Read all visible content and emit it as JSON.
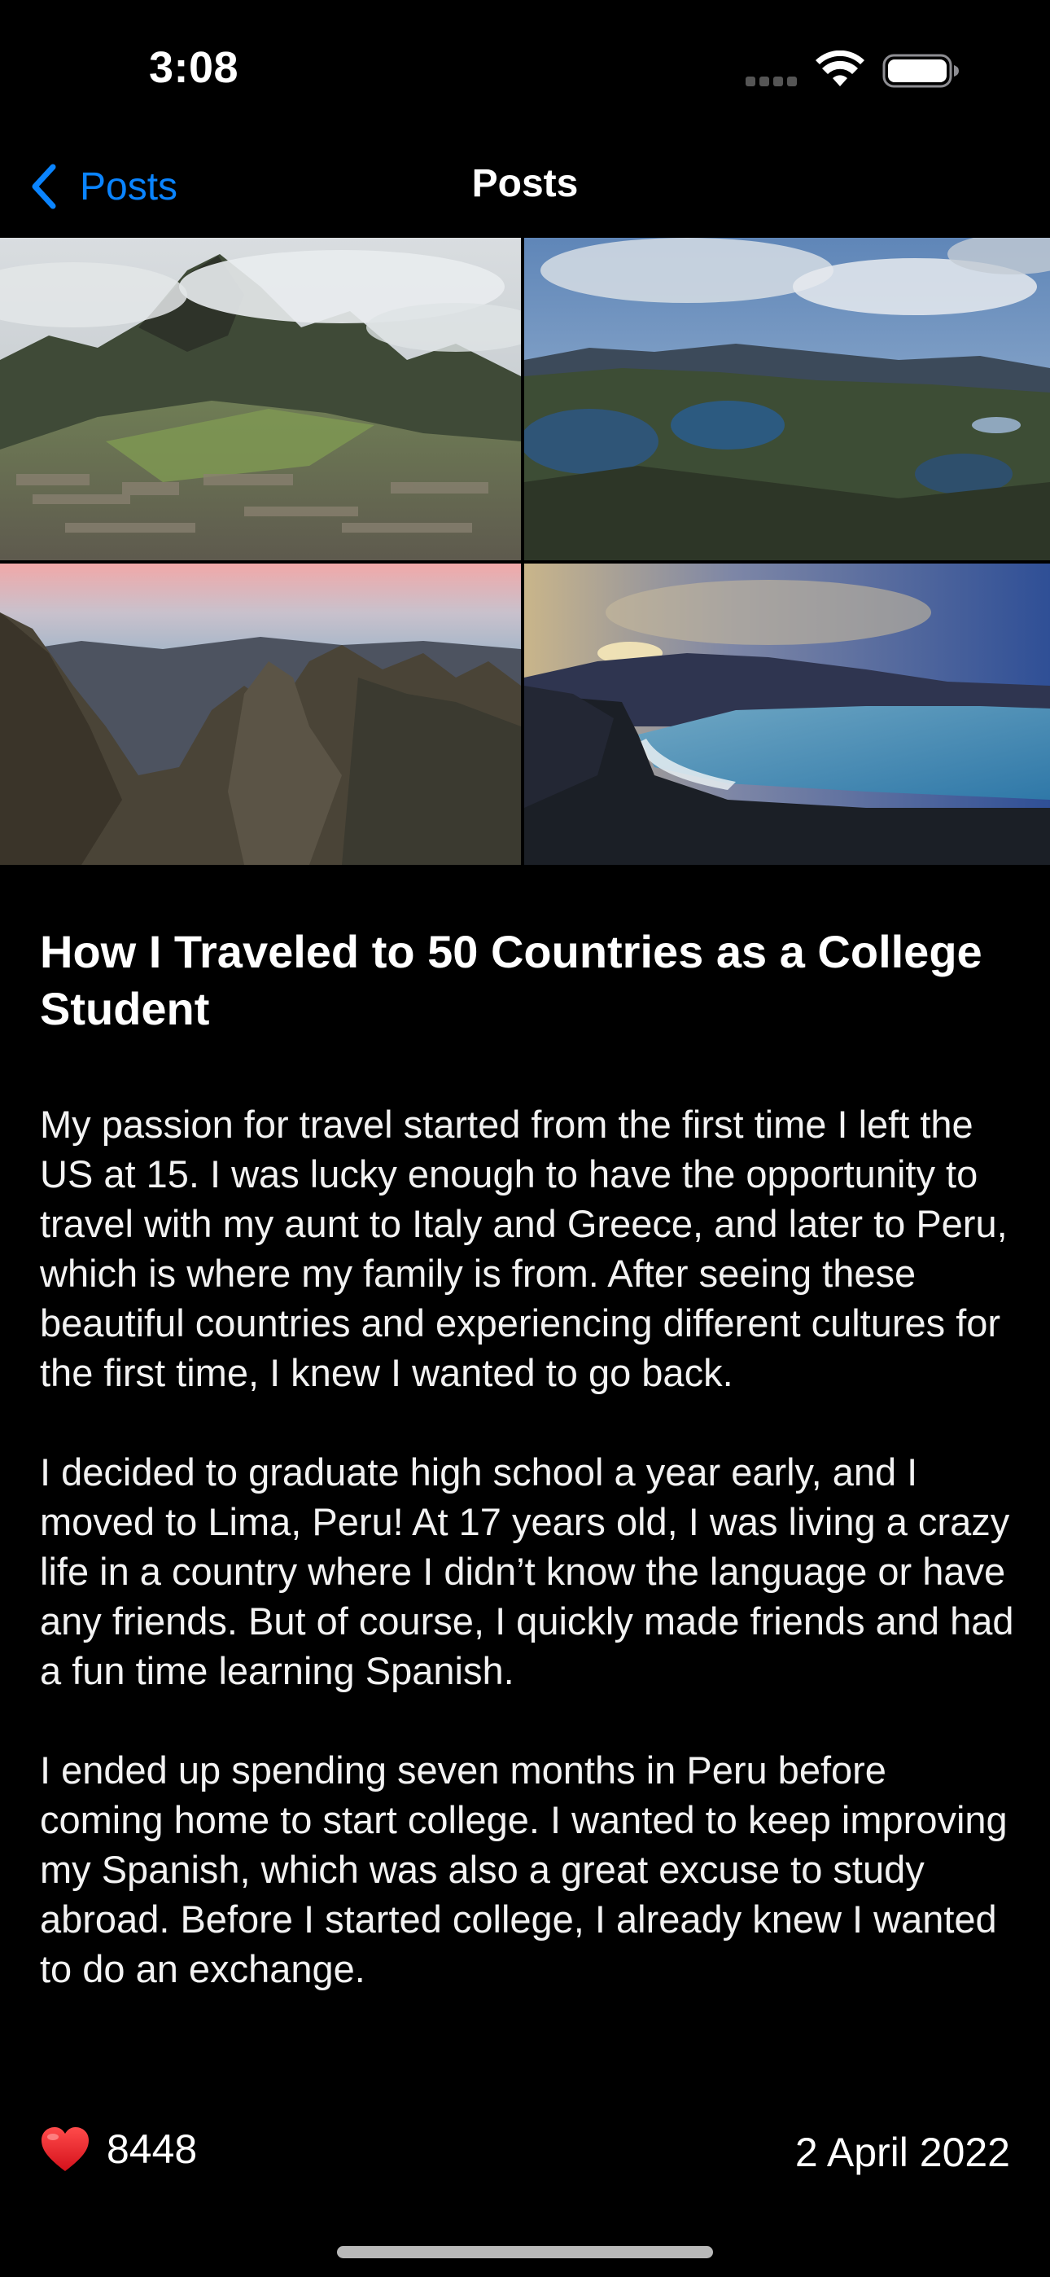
{
  "status_bar": {
    "time": "3:08",
    "icons": [
      "cellular-signal-icon",
      "wifi-icon",
      "battery-icon"
    ]
  },
  "nav": {
    "back_label": "Posts",
    "title": "Posts",
    "accent_color": "#0a84ff"
  },
  "photos": [
    {
      "name": "mountain-ruins-photo"
    },
    {
      "name": "mountain-lakes-photo"
    },
    {
      "name": "rocky-peaks-photo"
    },
    {
      "name": "coastal-bay-sunset-photo"
    }
  ],
  "post": {
    "title": "How I Traveled to 50 Countries as a College Student",
    "paragraphs": [
      "My passion for travel started from the first time I left the US at 15. I was lucky enough to have the opportunity to travel with my aunt to Italy and Greece, and later to Peru, which is where my family is from. After seeing these beautiful countries and experiencing different cultures for the first time, I knew I wanted to go back.",
      "I decided to graduate high school a year early, and I moved to Lima, Peru! At 17 years old, I was living a crazy life in a country where I didn’t know the language or have any friends. But of course, I quickly made friends and had a fun time learning Spanish.",
      "I ended up spending seven months in Peru before coming home to start college. I wanted to keep improving my Spanish, which was also a great excuse to study abroad. Before I started college, I already knew I wanted to do an exchange."
    ],
    "likes": "8448",
    "date": "2 April 2022"
  }
}
